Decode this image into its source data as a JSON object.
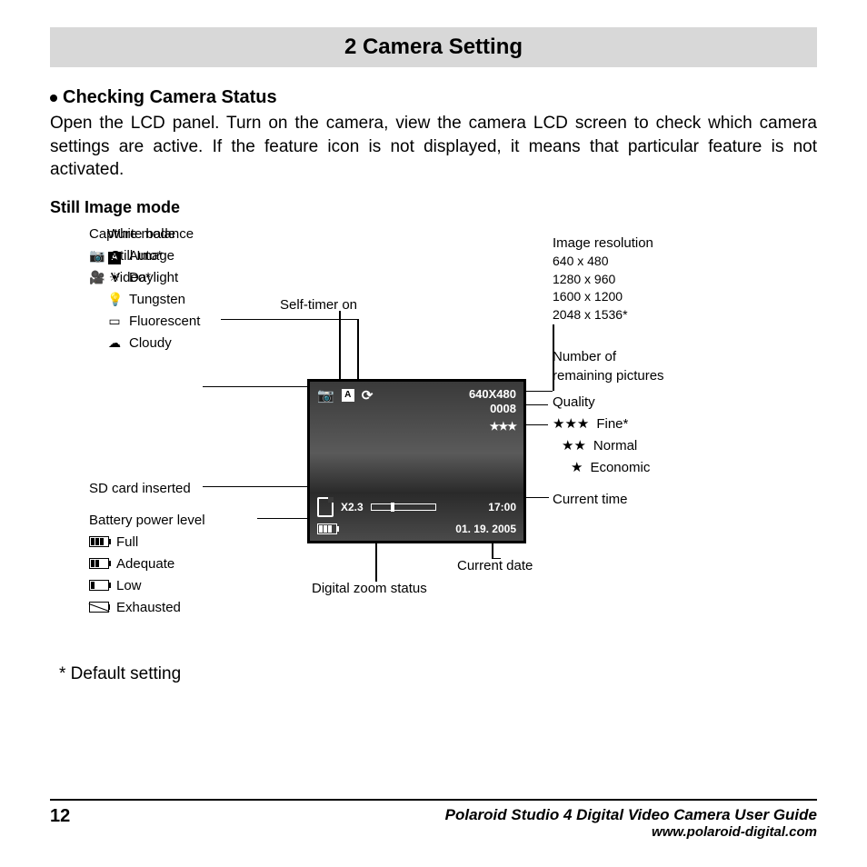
{
  "title": "2 Camera Setting",
  "sub_heading": "Checking Camera Status",
  "body": "Open the LCD panel. Turn on the camera, view the camera LCD screen to check which camera settings are active. If the feature icon is not displayed, it means that particular feature is not activated.",
  "mode_heading": "Still Image mode",
  "default_note": "* Default setting",
  "footer": {
    "page": "12",
    "guide": "Polaroid Studio 4 Digital Video Camera User Guide",
    "url": "www.polaroid-digital.com"
  },
  "legend": {
    "white_balance": {
      "title": "White balance",
      "items": [
        "Auto*",
        "Daylight",
        "Tungsten",
        "Fluorescent",
        "Cloudy"
      ]
    },
    "capture_mode": {
      "title": "Capture mode",
      "items": [
        "Still Image",
        "Video*"
      ]
    },
    "sd": "SD card inserted",
    "battery": {
      "title": "Battery power level",
      "items": [
        "Full",
        "Adequate",
        "Low",
        "Exhausted"
      ]
    },
    "self_timer": "Self-timer on",
    "resolution": {
      "title": "Image resolution",
      "items": [
        "640 x 480",
        "1280 x 960",
        "1600 x 1200",
        "2048 x 1536*"
      ]
    },
    "remaining": "Number of\nremaining pictures",
    "quality": {
      "title": "Quality",
      "items": [
        "Fine*",
        "Normal",
        "Economic"
      ]
    },
    "current_time": "Current time",
    "current_date": "Current date",
    "zoom": "Digital zoom status"
  },
  "lcd": {
    "res": "640X480",
    "count": "0008",
    "zoom": "X2.3",
    "time": "17:00",
    "date": "01. 19. 2005",
    "stars": "★★★"
  }
}
